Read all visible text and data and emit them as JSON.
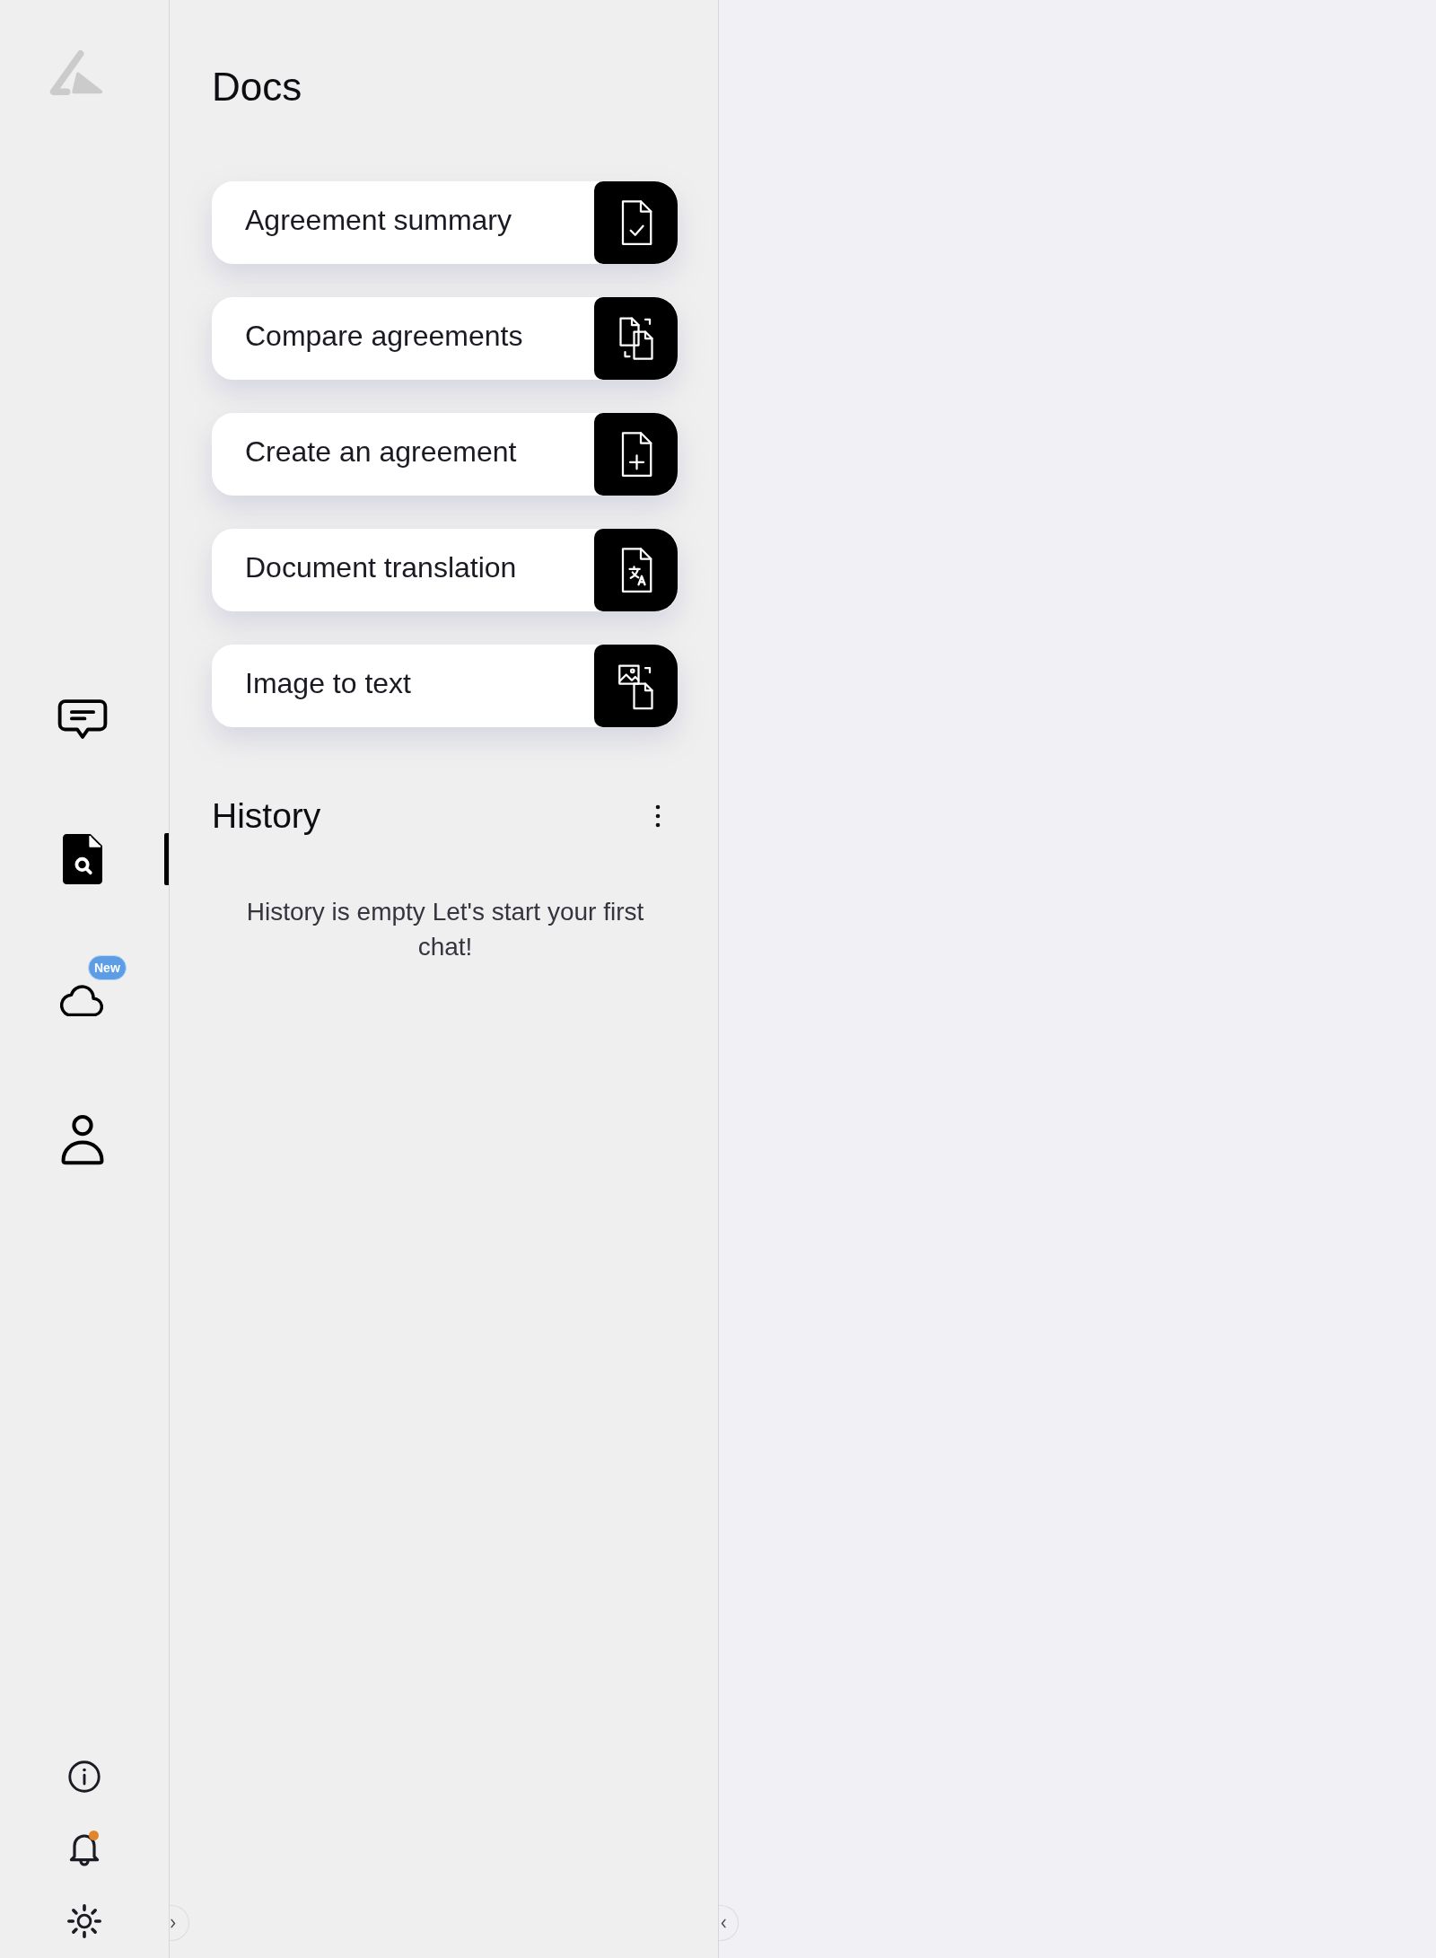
{
  "rail": {
    "nav_items": [
      {
        "kind": "chat",
        "selected": false
      },
      {
        "kind": "docs",
        "selected": true
      },
      {
        "kind": "cloud",
        "selected": false,
        "badge": "New"
      },
      {
        "kind": "profile",
        "selected": false
      }
    ],
    "footer_items": [
      {
        "kind": "info"
      },
      {
        "kind": "notifications",
        "unread": true
      },
      {
        "kind": "theme"
      }
    ]
  },
  "docs_panel": {
    "title": "Docs",
    "actions": [
      {
        "kind": "summary",
        "label": "Agreement summary"
      },
      {
        "kind": "compare",
        "label": "Compare agreements"
      },
      {
        "kind": "create",
        "label": "Create an agreement"
      },
      {
        "kind": "translate",
        "label": "Document translation"
      },
      {
        "kind": "image_to_text",
        "label": "Image to text"
      }
    ],
    "history": {
      "title": "History",
      "empty_message": "History is empty Let's start your first chat!"
    }
  }
}
